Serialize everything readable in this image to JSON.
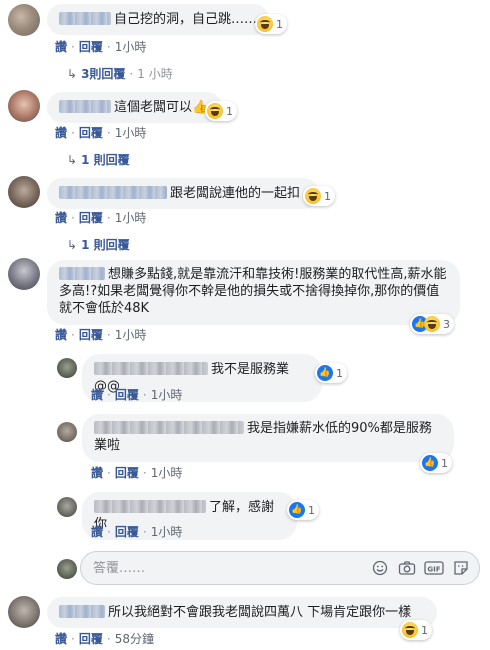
{
  "comments": [
    {
      "text": "自己挖的洞，自己跳……",
      "reaction": {
        "count": "1"
      },
      "actions": {
        "like": "讚",
        "reply": "回覆",
        "time": "1小時"
      },
      "replies": {
        "label": "3則回覆",
        "time": "1 小時"
      }
    },
    {
      "text": "這個老闆可以",
      "emoji_inline": "👍",
      "reaction": {
        "count": "1"
      },
      "actions": {
        "like": "讚",
        "reply": "回覆",
        "time": "1小時"
      },
      "replies": {
        "label": "1 則回覆"
      }
    },
    {
      "text": "跟老闆說連他的一起扣",
      "reaction": {
        "count": "1"
      },
      "actions": {
        "like": "讚",
        "reply": "回覆",
        "time": "1小時"
      },
      "replies": {
        "label": "1 則回覆"
      }
    },
    {
      "text": "想賺多點錢,就是靠流汗和靠技術!服務業的取代性高,薪水能多高!?如果老闆覺得你不幹是他的損失或不捨得換掉你,那你的價值就不會低於48K",
      "reaction": {
        "count": "3"
      },
      "actions": {
        "like": "讚",
        "reply": "回覆",
        "time": "1小時"
      }
    }
  ],
  "nested_replies": [
    {
      "text": "我不是服務業@@",
      "reaction": {
        "count": "1"
      },
      "actions": {
        "like": "讚",
        "reply": "回覆",
        "time": "1小時"
      }
    },
    {
      "text": "我是指嫌薪水低的90%都是服務業啦",
      "reaction": {
        "count": "1"
      },
      "actions": {
        "like": "讚",
        "reply": "回覆",
        "time": "1小時"
      }
    },
    {
      "text": "了解，感謝你",
      "reaction": {
        "count": "1"
      },
      "actions": {
        "like": "讚",
        "reply": "回覆",
        "time": "1小時"
      }
    }
  ],
  "reply_box": {
    "placeholder": "答覆……",
    "icons": [
      "smiley-icon",
      "camera-icon",
      "gif-icon",
      "sticker-icon"
    ],
    "gif_label": "GIF"
  },
  "last_comment": {
    "text": "所以我絕對不會跟我老闆說四萬八 下場肯定跟你一樣",
    "reaction": {
      "count": "1"
    },
    "actions": {
      "like": "讚",
      "reply": "回覆",
      "time": "58分鐘"
    }
  },
  "colors": {
    "link": "#385898",
    "bubble": "#f2f3f5",
    "like_blue": "#1877f2"
  }
}
